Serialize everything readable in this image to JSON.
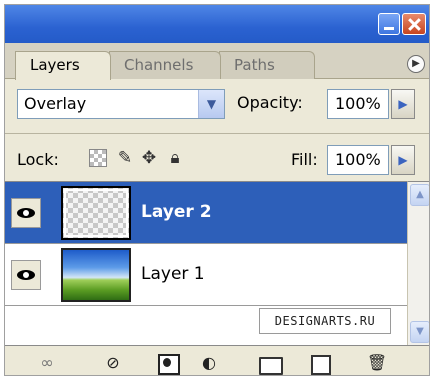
{
  "window": {
    "minimize_icon": "minimize-icon",
    "close_icon": "close-icon"
  },
  "tabs": [
    {
      "label": "Layers",
      "active": true
    },
    {
      "label": "Channels",
      "active": false
    },
    {
      "label": "Paths",
      "active": false
    }
  ],
  "options": {
    "blend_mode": "Overlay",
    "opacity_label": "Opacity:",
    "opacity_value": "100%",
    "lock_label": "Lock:",
    "fill_label": "Fill:",
    "fill_value": "100%"
  },
  "layers": [
    {
      "name": "Layer 2",
      "visible": true,
      "selected": true,
      "thumbnail": "transparent-checker"
    },
    {
      "name": "Layer 1",
      "visible": true,
      "selected": false,
      "thumbnail": "sky-field-photo"
    }
  ],
  "watermark": "DESIGNARTS.RU",
  "colors": {
    "selection": "#2d5fb9",
    "titlebar": "#2b62d1",
    "panel_bg": "#ece9d8"
  },
  "toolbar_icons": [
    "link-layers-icon",
    "layer-style-icon",
    "layer-mask-icon",
    "adjustment-layer-icon",
    "new-group-icon",
    "new-layer-icon",
    "delete-layer-icon"
  ]
}
